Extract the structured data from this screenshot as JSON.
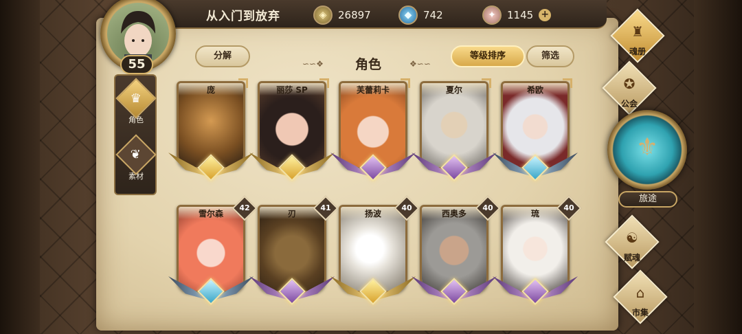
{
  "player": {
    "name": "从入门到放弃",
    "level": "55"
  },
  "currencies": [
    {
      "icon": "gold-coin-icon",
      "value": "26897"
    },
    {
      "icon": "blue-crystal-icon",
      "value": "742"
    },
    {
      "icon": "pink-gem-icon",
      "value": "1145"
    }
  ],
  "plus_label": "+",
  "sidebar": {
    "items": [
      {
        "label": "角色",
        "active": true
      },
      {
        "label": "素材",
        "active": false
      }
    ]
  },
  "controls": {
    "decompose": "分解",
    "title": "角色",
    "sort": "等级排序",
    "filter": "筛选"
  },
  "cards": [
    {
      "name": "庞",
      "tier": "gold",
      "level": ""
    },
    {
      "name": "丽莎 SP",
      "tier": "gold",
      "level": ""
    },
    {
      "name": "芙蕾莉卡",
      "tier": "purple",
      "level": ""
    },
    {
      "name": "夏尔",
      "tier": "purple",
      "level": ""
    },
    {
      "name": "希欧",
      "tier": "blue",
      "level": ""
    },
    {
      "name": "雪尔森",
      "tier": "blue",
      "level": "42"
    },
    {
      "name": "刃",
      "tier": "purple",
      "level": "41"
    },
    {
      "name": "扬波",
      "tier": "gold",
      "level": "40"
    },
    {
      "name": "西奥多",
      "tier": "purple",
      "level": "40"
    },
    {
      "name": "琉",
      "tier": "purple",
      "level": "40"
    }
  ],
  "right_nav": {
    "soulbook": "魂册",
    "guild": "公会",
    "journey": "旅途",
    "talent": "赋魂",
    "market": "市集"
  },
  "colors": {
    "accent_gold": "#d7b46a",
    "parchment": "#e3d3ad",
    "frame_dark": "#2e241b"
  }
}
